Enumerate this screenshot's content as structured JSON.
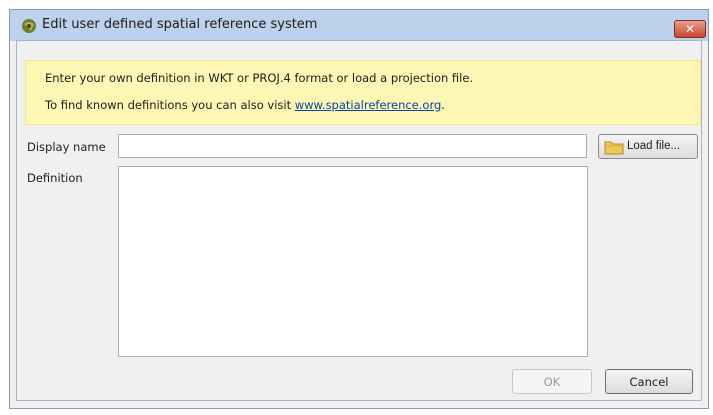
{
  "window": {
    "title": "Edit user defined spatial reference system",
    "close_symbol": "✕",
    "app_icon": "app-logo-icon"
  },
  "info": {
    "line1": "Enter your own definition in WKT or PROJ.4 format or load a projection file.",
    "line2_prefix": "To find known definitions you can also visit ",
    "link_text": "www.spatialreference.org",
    "line2_suffix": ".",
    "background_color": "#fef6b4",
    "link_color": "#0645ad"
  },
  "form": {
    "display_name_label": "Display name",
    "display_name_value": "",
    "definition_label": "Definition",
    "definition_value": "",
    "load_button_label": "Load file...",
    "load_button_icon": "folder-icon"
  },
  "footer": {
    "ok_label": "OK",
    "ok_enabled": false,
    "cancel_label": "Cancel"
  },
  "colors": {
    "titlebar": "#bcd2ec",
    "close_button": "#c8472f"
  }
}
